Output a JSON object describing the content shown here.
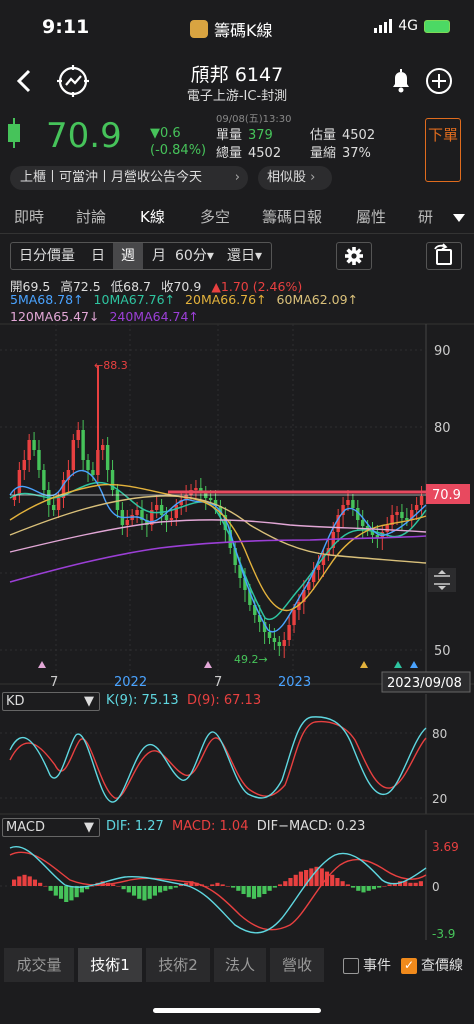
{
  "status_bar": {
    "time": "9:11",
    "app_name": "籌碼K線",
    "network": "4G"
  },
  "nav": {
    "title": "頎邦 6147",
    "subtitle": "電子上游-IC-封測",
    "icons": [
      "back-icon",
      "radar-icon",
      "bell-icon",
      "plus-icon"
    ]
  },
  "quote": {
    "price": "70.9",
    "change": "▼0.6",
    "change_pct": "(-0.84%)",
    "timestamp": "09/08(五)13:30",
    "single_vol_label": "單量",
    "single_vol": "379",
    "total_vol_label": "總量",
    "total_vol": "4502",
    "est_vol_label": "估量",
    "est_vol": "4502",
    "vol_ratio_label": "量縮",
    "vol_ratio": "37%",
    "sell_label": "下單",
    "info_line": "上櫃丨可當沖丨月營收公告今天",
    "similar_label": "相似股"
  },
  "tabs": [
    "即時",
    "討論",
    "K線",
    "多空",
    "籌碼日報",
    "屬性",
    "研"
  ],
  "periods": [
    "日分價量",
    "日",
    "週",
    "月",
    "60分▾",
    "還日▾"
  ],
  "ohlc": {
    "open": "開69.5",
    "high": "高72.5",
    "low": "低68.7",
    "close": "收70.9",
    "change": "▲1.70 (2.46%)"
  },
  "ma": {
    "ma5": "5MA68.78↑",
    "ma10": "10MA67.76↑",
    "ma20": "20MA66.76↑",
    "ma60": "60MA62.09↑",
    "ma120": "120MA65.47↓",
    "ma240": "240MA64.74↑"
  },
  "price_axis": {
    "ticks": [
      "90",
      "80",
      "70",
      "60",
      "50"
    ],
    "last_price": "70.9",
    "high_marker": "88.3",
    "low_marker": "49.2",
    "date_labels": [
      "7",
      "2022",
      "7",
      "2023"
    ],
    "cursor_date": "2023/09/08"
  },
  "kd": {
    "selector": "KD",
    "k": "K(9): 75.13",
    "d": "D(9): 67.13",
    "ticks": [
      "80",
      "50",
      "20"
    ]
  },
  "macd": {
    "selector": "MACD",
    "dif": "DIF: 1.27",
    "macd": "MACD: 1.04",
    "osc": "DIF−MACD: 0.23",
    "ticks": [
      "3.69",
      "0",
      "-3.9"
    ]
  },
  "bottom_tabs": [
    "成交量",
    "技術1",
    "技術2",
    "法人",
    "營收"
  ],
  "checkboxes": {
    "event": "事件",
    "price_line": "查價線"
  },
  "colors": {
    "up": "#e84040",
    "down": "#46c35a",
    "ma5": "#4aa3ff",
    "ma10": "#2ec4a0",
    "ma20": "#e3b23c",
    "ma60": "#d9c07a",
    "ma120": "#e2a7d6",
    "ma240": "#9b3fd6",
    "accent": "#f08a1c"
  }
}
